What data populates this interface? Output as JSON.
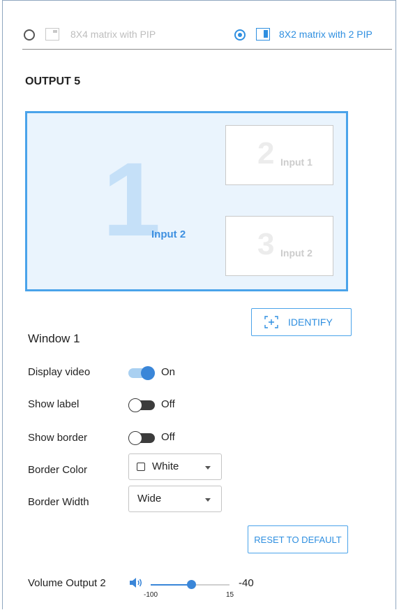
{
  "layouts": [
    {
      "label": "8X4 matrix with PIP",
      "selected": false
    },
    {
      "label": "8X2 matrix with 2 PIP",
      "selected": true
    }
  ],
  "output": {
    "title": "OUTPUT 5"
  },
  "preview": {
    "main": {
      "number": "1",
      "label": "Input 2"
    },
    "pips": [
      {
        "number": "2",
        "label": "Input 1"
      },
      {
        "number": "3",
        "label": "Input 2"
      }
    ]
  },
  "identify": {
    "label": "IDENTIFY"
  },
  "window": {
    "title": "Window 1",
    "display_video": {
      "label": "Display video",
      "state": "On",
      "on": true
    },
    "show_label": {
      "label": "Show label",
      "state": "Off",
      "on": false
    },
    "show_border": {
      "label": "Show border",
      "state": "Off",
      "on": false
    },
    "border_color": {
      "label": "Border Color",
      "value": "White"
    },
    "border_width": {
      "label": "Border Width",
      "value": "Wide"
    }
  },
  "reset": {
    "label": "RESET TO DEFAULT"
  },
  "volume": {
    "label": "Volume Output 2",
    "min": "-100",
    "max": "15",
    "value": "-40",
    "min_num": -100,
    "max_num": 15,
    "value_num": -40
  },
  "colors": {
    "accent": "#2f8fe0",
    "preview_border": "#4aa3ea",
    "preview_bg": "#eaf4fd"
  }
}
